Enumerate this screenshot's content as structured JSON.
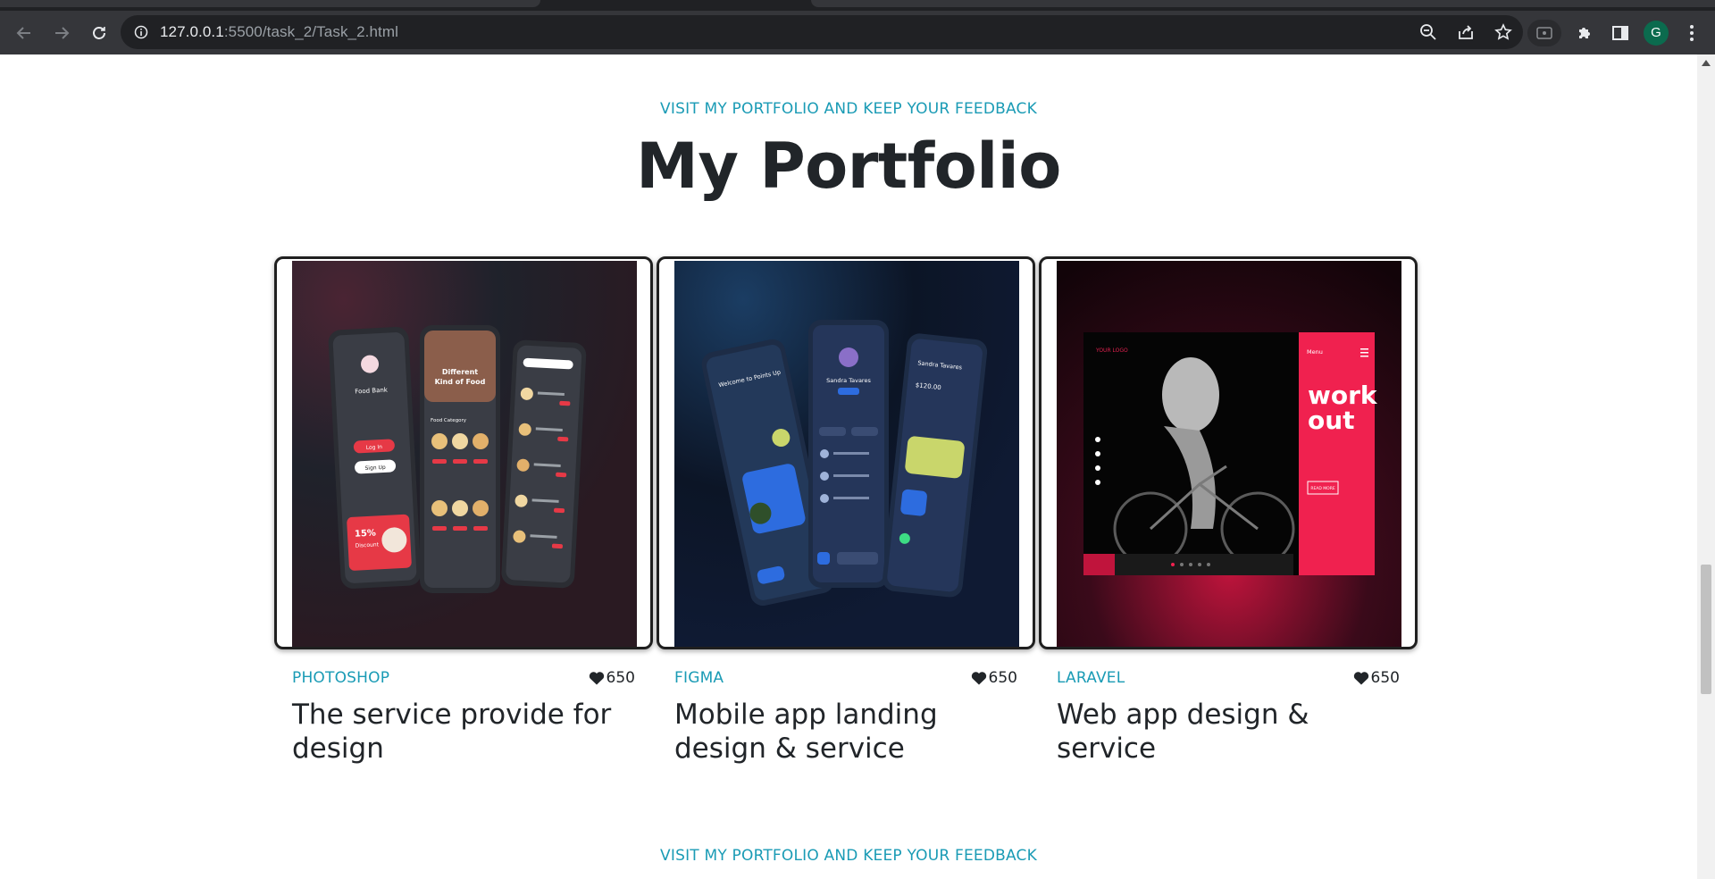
{
  "browser": {
    "url_host": "127.0.0.1",
    "url_rest": ":5500/task_2/Task_2.html",
    "profile_initial": "G"
  },
  "icons": {
    "back": "back-arrow-icon",
    "forward": "forward-arrow-icon",
    "reload": "reload-icon",
    "site_info": "info-icon",
    "zoom": "zoom-out-icon",
    "share": "share-icon",
    "bookmark": "star-icon",
    "cast": "cast-icon",
    "extensions": "puzzle-icon",
    "side_panel": "side-panel-icon",
    "menu": "kebab-menu-icon",
    "like": "heart-icon"
  },
  "colors": {
    "accent": "#1a9bb5",
    "text": "#212529"
  },
  "section": {
    "eyebrow": "VISIT MY PORTFOLIO AND KEEP YOUR FEEDBACK",
    "title": "My Portfolio",
    "next_eyebrow": "VISIT MY PORTFOLIO AND KEEP YOUR FEEDBACK"
  },
  "cards": [
    {
      "category": "PHOTOSHOP",
      "likes": "650",
      "title": "The service provide for design",
      "mockup": {
        "app_name": "Food Bank",
        "hero_line1": "Different",
        "hero_line2": "Kind of Food",
        "login": "Log In",
        "signup": "Sign Up",
        "section_label": "Food Category",
        "promo_pct": "15%",
        "promo_word": "Discount"
      }
    },
    {
      "category": "FIGMA",
      "likes": "650",
      "title": "Mobile app landing design & service",
      "mockup": {
        "welcome": "Welcome to Points Up",
        "profile_name": "Sandra Tavares",
        "balance": "$120.00"
      }
    },
    {
      "category": "LARAVEL",
      "likes": "650",
      "title": "Web app design & service",
      "mockup": {
        "headline_1": "work",
        "headline_2": "out",
        "menu_label": "Menu",
        "cta": "READ MORE",
        "brand": "YOUR LOGO"
      }
    }
  ]
}
